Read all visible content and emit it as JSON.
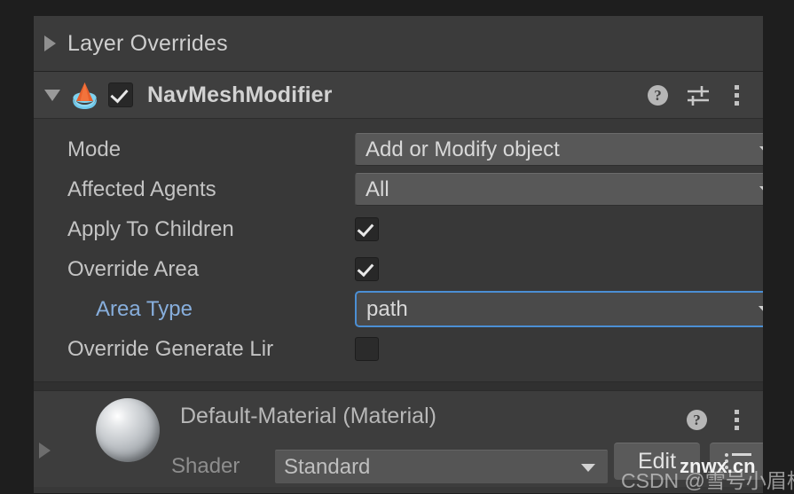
{
  "layer_overrides": {
    "title": "Layer Overrides",
    "foldout_icon": "triangle-right-icon",
    "expanded": false
  },
  "component": {
    "title": "NavMeshModifier",
    "foldout_icon": "triangle-down-icon",
    "component_icon": "navmesh-modifier-icon",
    "enabled": true,
    "enabled_check_glyph": "checkmark-icon",
    "header_icons": {
      "help": "?",
      "help_name": "help-icon",
      "preset": "preset-settings-icon",
      "menu": "kebab-menu-icon"
    },
    "properties": [
      {
        "label": "Mode",
        "type": "dropdown",
        "value": "Add or Modify object",
        "override": false,
        "focused": false
      },
      {
        "label": "Affected Agents",
        "type": "dropdown",
        "value": "All",
        "override": false,
        "focused": false
      },
      {
        "label": "Apply To Children",
        "type": "checkbox",
        "checked": true,
        "override": false
      },
      {
        "label": "Override Area",
        "type": "checkbox",
        "checked": true,
        "override": false
      },
      {
        "label": "Area Type",
        "type": "dropdown",
        "value": "path",
        "override": true,
        "focused": true,
        "indented": true
      },
      {
        "label": "Override Generate Lir",
        "type": "checkbox",
        "checked": false,
        "override": false,
        "clipped": true
      }
    ]
  },
  "material": {
    "name": "Default-Material (Material)",
    "preview_icon": "material-sphere-preview",
    "foldout_icon": "triangle-right-icon",
    "shader_label": "Shader",
    "shader_value": "Standard",
    "edit_label": "Edit",
    "queue_icon": "render-queue-list-icon",
    "header_icons": {
      "help": "?",
      "help_name": "help-icon",
      "menu": "kebab-menu-icon"
    }
  },
  "watermarks": {
    "csdn": "CSDN @雪号小眉梢",
    "site": "znwx.cn"
  },
  "colors": {
    "panel_bg": "#383838",
    "header_bg": "#3f3f3f",
    "outer_bg": "#1e1e1e",
    "label": "#c4c4c4",
    "override_label": "#87aedc",
    "focus_border": "#4b8fd4",
    "field_bg": "#585858",
    "icon_orange": "#e8602c",
    "icon_blue": "#69c6e8"
  }
}
